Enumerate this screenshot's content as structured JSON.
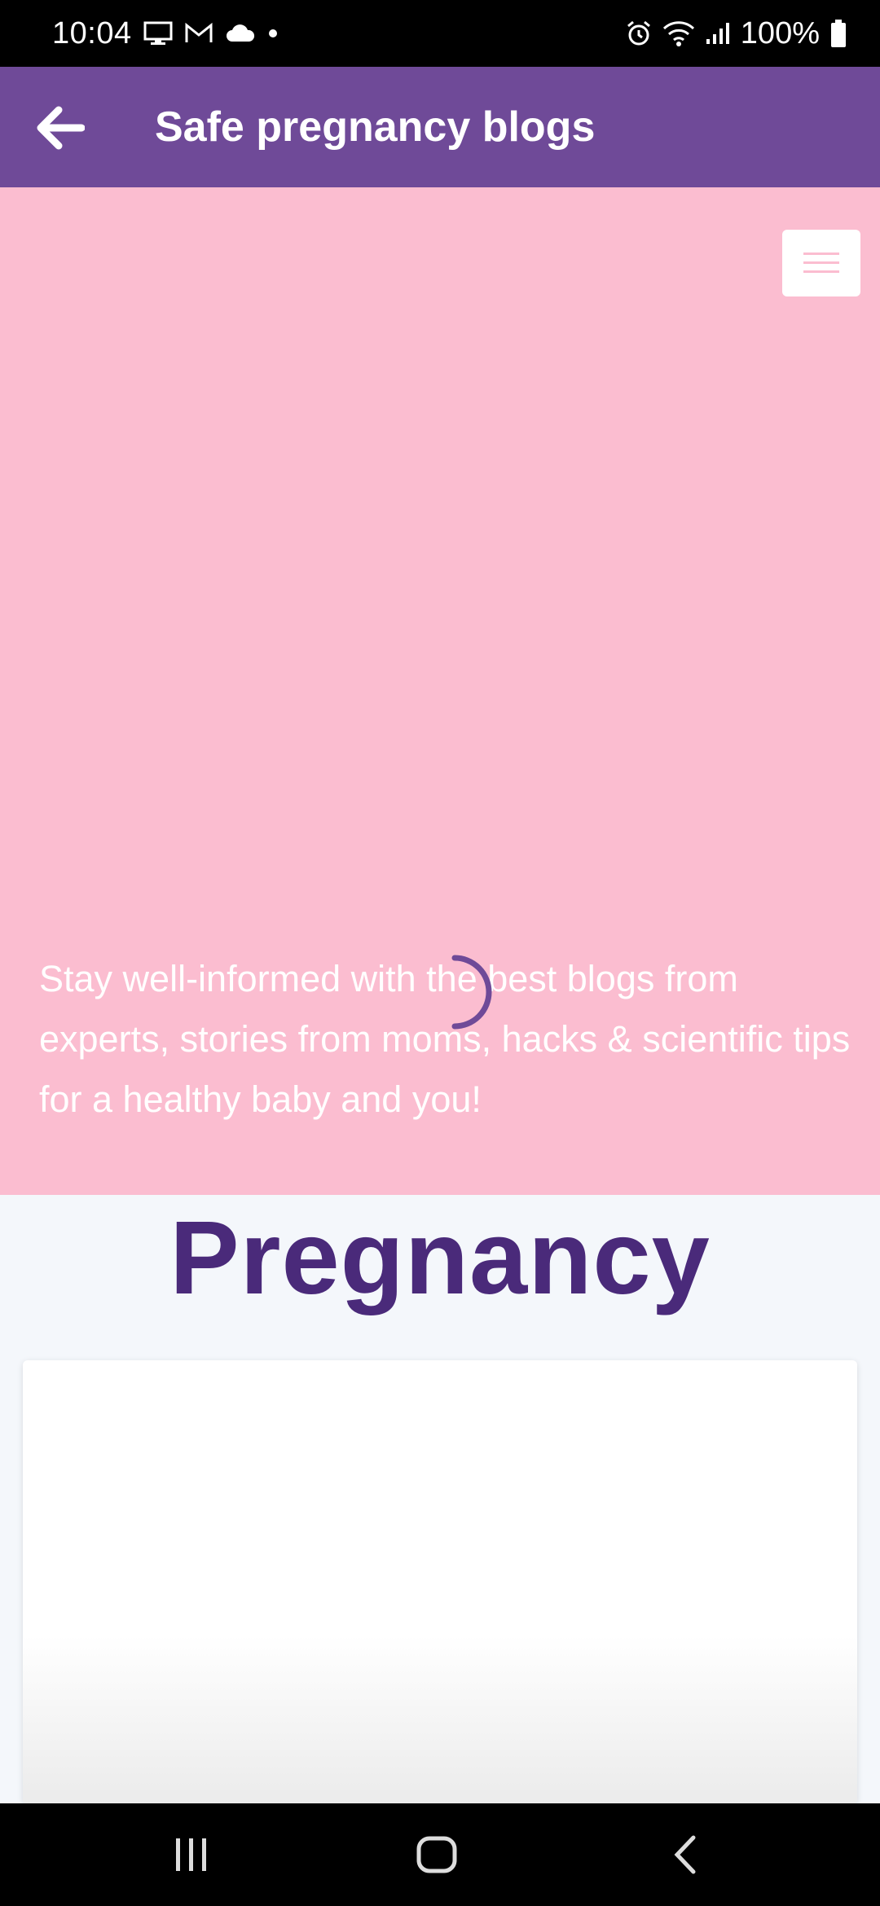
{
  "status_bar": {
    "time": "10:04",
    "battery_text": "100%",
    "left_icons": [
      "screen-cast-icon",
      "gmail-icon",
      "cloud-icon",
      "dot-icon"
    ],
    "right_icons": [
      "alarm-icon",
      "wifi-icon",
      "signal-icon",
      "battery-icon"
    ]
  },
  "app_bar": {
    "title": "Safe pregnancy blogs",
    "back_icon": "arrow-left-icon",
    "color": "#6f4a98"
  },
  "hero": {
    "background": "#fbbdd0",
    "description": "Stay well-informed with the best blogs from experts, stories from moms, hacks & scientific tips for a healthy baby and you!",
    "menu_icon": "hamburger-menu-icon"
  },
  "section": {
    "title": "Pregnancy",
    "title_color": "#4a2a7a"
  },
  "nav_bar": {
    "icons": [
      "recent-apps-icon",
      "home-icon",
      "back-icon"
    ]
  }
}
